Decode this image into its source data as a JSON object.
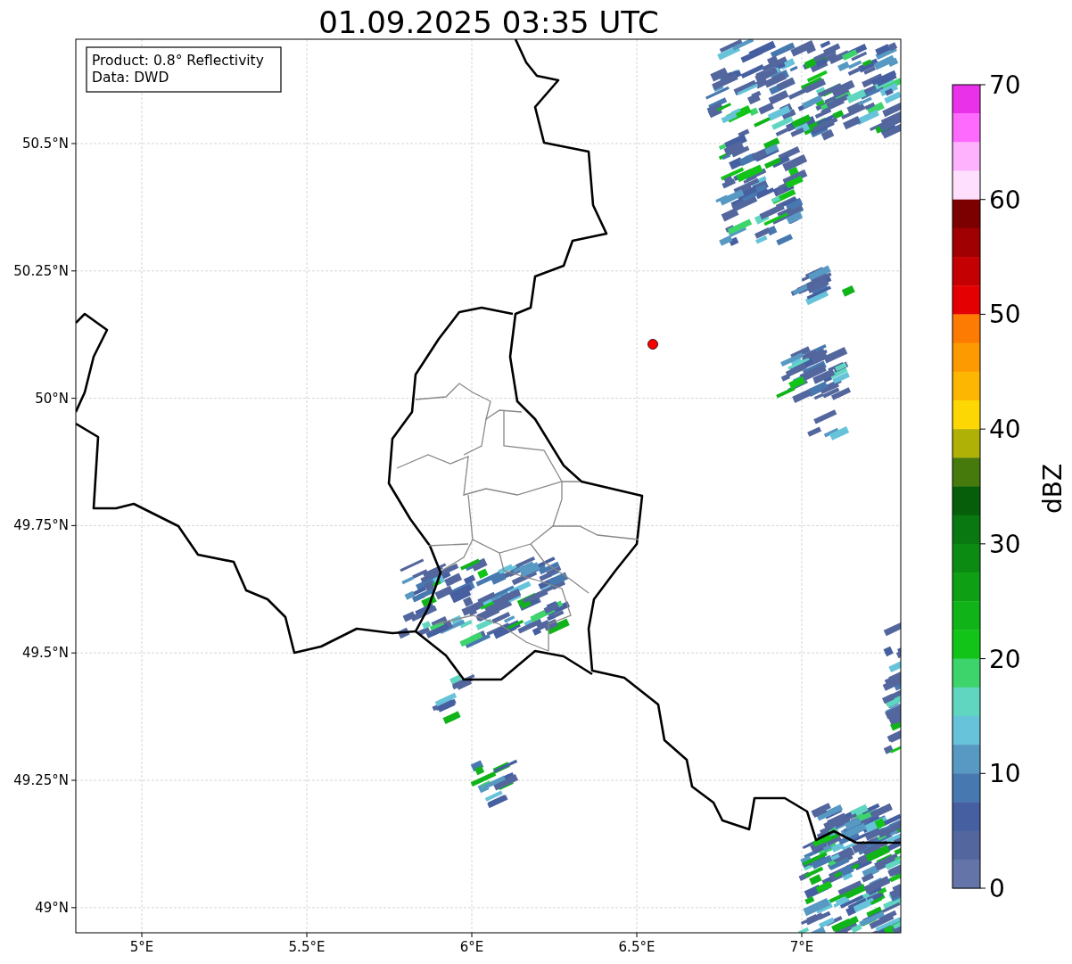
{
  "title": "01.09.2025 03:35 UTC",
  "info_box": {
    "lines": [
      "Product: 0.8° Reflectivity",
      "Data: DWD"
    ]
  },
  "map": {
    "x_ticks": [
      "5°E",
      "5.5°E",
      "6°E",
      "6.5°E",
      "7°E"
    ],
    "y_ticks": [
      "50.5°N",
      "50.25°N",
      "50°N",
      "49.75°N",
      "49.5°N",
      "49.25°N",
      "49°N"
    ]
  },
  "colorbar": {
    "label": "dBZ",
    "ticks": [
      "70",
      "60",
      "50",
      "40",
      "30",
      "20",
      "10",
      "0"
    ],
    "segments": [
      {
        "color": "#ea31ea"
      },
      {
        "color": "#fe6afe"
      },
      {
        "color": "#feb2fe"
      },
      {
        "color": "#fee0fe"
      },
      {
        "color": "#7d0001"
      },
      {
        "color": "#a00002"
      },
      {
        "color": "#c50002"
      },
      {
        "color": "#e40002"
      },
      {
        "color": "#fd7b02"
      },
      {
        "color": "#fd9a02"
      },
      {
        "color": "#fdb703"
      },
      {
        "color": "#fdd703"
      },
      {
        "color": "#b0b106"
      },
      {
        "color": "#477a0c"
      },
      {
        "color": "#075e0a"
      },
      {
        "color": "#0a7810"
      },
      {
        "color": "#0c8b12"
      },
      {
        "color": "#0e9f14"
      },
      {
        "color": "#10b419"
      },
      {
        "color": "#13c418"
      },
      {
        "color": "#3dd46c"
      },
      {
        "color": "#60d6c0"
      },
      {
        "color": "#67c3da"
      },
      {
        "color": "#5799c3"
      },
      {
        "color": "#4779b0"
      },
      {
        "color": "#465fa0"
      },
      {
        "color": "#53679e"
      },
      {
        "color": "#6574a8"
      }
    ]
  }
}
